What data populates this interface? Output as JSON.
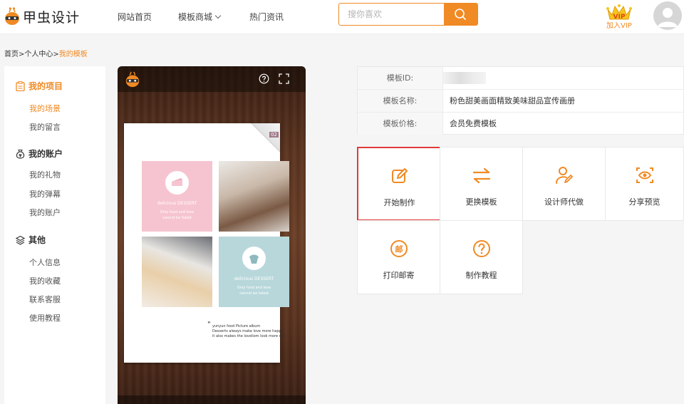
{
  "header": {
    "logo_text": "甲虫设计",
    "nav": [
      "网站首页",
      "模板商城",
      "热门资讯"
    ],
    "search_placeholder": "搜你喜欢",
    "vip_badge": "VIP",
    "vip_label": "加入VIP",
    "accent_color": "#f08a24"
  },
  "breadcrumb": {
    "part1": "首页>个人中心>",
    "current": "我的模板"
  },
  "sidebar": {
    "groups": [
      {
        "title": "我的项目",
        "icon": "clipboard-icon",
        "items": [
          "我的场景",
          "我的留言"
        ]
      },
      {
        "title": "我的账户",
        "icon": "money-bag-icon",
        "items": [
          "我的礼物",
          "我的弹幕",
          "我的账户"
        ]
      },
      {
        "title": "其他",
        "icon": "layers-icon",
        "items": [
          "个人信息",
          "我的收藏",
          "联系客服",
          "使用教程"
        ]
      }
    ]
  },
  "preview": {
    "page_number": "02",
    "tile1_title": "delicious DESSERT",
    "tile1_sub1": "Only food and love",
    "tile1_sub2": "cannot be faked",
    "tile2_title": "delicious DESSERT",
    "tile2_sub1": "Only food and love",
    "tile2_sub2": "cannot be faked",
    "quote_line1": "yunyun food Picture album",
    "quote_line2": "Desserts always make love more happy",
    "quote_line3": "it also makes the loveliom look more sac"
  },
  "info": {
    "rows": [
      {
        "label": "模板ID:",
        "value": ""
      },
      {
        "label": "模板名称:",
        "value": "粉色甜美画面精致美味甜品宣传画册"
      },
      {
        "label": "模板价格:",
        "value": "会员免费模板"
      }
    ]
  },
  "actions": [
    {
      "label": "开始制作",
      "icon": "edit-icon"
    },
    {
      "label": "更换模板",
      "icon": "swap-icon"
    },
    {
      "label": "设计师代做",
      "icon": "designer-icon"
    },
    {
      "label": "分享预览",
      "icon": "eye-icon"
    },
    {
      "label": "打印邮寄",
      "icon": "mail-icon"
    },
    {
      "label": "制作教程",
      "icon": "help-icon"
    }
  ]
}
